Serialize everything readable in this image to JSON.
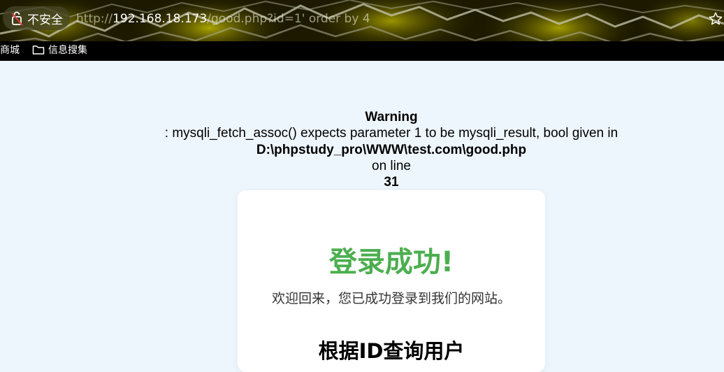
{
  "browser": {
    "security_label": "不安全",
    "url_host": "192.168.18.173",
    "url_scheme": "http://",
    "url_rest": "/good.php?id=1' order by 4",
    "bookmarks": [
      {
        "label": "商城"
      },
      {
        "label": "信息搜集"
      }
    ]
  },
  "warning": {
    "title": "Warning",
    "message": ": mysqli_fetch_assoc() expects parameter 1 to be mysqli_result, bool given in",
    "path": "D:\\phpstudy_pro\\WWW\\test.com\\good.php",
    "on_line": "on line",
    "line": "31"
  },
  "card": {
    "title": "登录成功!",
    "subtitle": "欢迎回来，您已成功登录到我们的网站。",
    "heading": "根据ID查询用户",
    "accent_color": "#4cae4f"
  }
}
